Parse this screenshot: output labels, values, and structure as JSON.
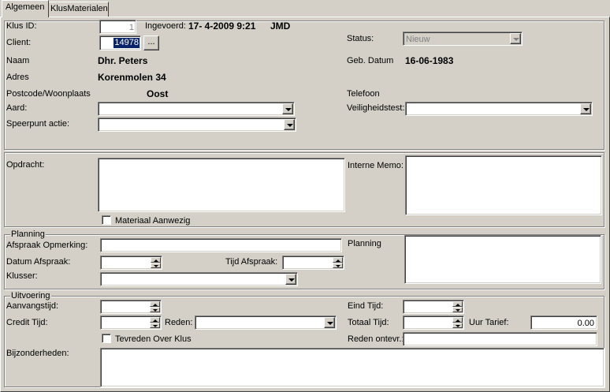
{
  "tabs": [
    {
      "label": "Algemeen",
      "active": true
    },
    {
      "label": "KlusMaterialen",
      "active": false
    }
  ],
  "klus": {
    "id_label": "Klus ID:",
    "id_value": "1",
    "ingevoerd_label": "Ingevoerd:",
    "ingevoerd_value": "17- 4-2009 9:21",
    "user_value": "JMD",
    "client_label": "Client:",
    "client_value": "14978",
    "client_browse": "...",
    "status_label": "Status:",
    "status_value": "Nieuw",
    "naam_label": "Naam",
    "naam_value": "Dhr. Peters",
    "geb_label": "Geb. Datum",
    "geb_value": "16-06-1983",
    "adres_label": "Adres",
    "adres_value": "Korenmolen 34",
    "postcode_label": "Postcode/Woonplaats",
    "postcode_value": "Oost",
    "telefoon_label": "Telefoon",
    "aard_label": "Aard:",
    "aard_value": "",
    "veiligheid_label": "Veiligheidstest:",
    "veiligheid_value": "",
    "speerpunt_label": "Speerpunt actie:",
    "speerpunt_value": ""
  },
  "opdracht": {
    "opdracht_label": "Opdracht:",
    "memo_label": "Interne Memo:",
    "materiaal_label": "Materiaal Aanwezig"
  },
  "planning": {
    "group_label": "Planning",
    "opmerking_label": "Afspraak Opmerking:",
    "planning_label": "Planning",
    "datum_label": "Datum Afspraak:",
    "tijd_label": "Tijd Afspraak:",
    "klusser_label": "Klusser:"
  },
  "uitvoering": {
    "group_label": "Uitvoering",
    "aanvang_label": "Aanvangstijd:",
    "eind_label": "Eind Tijd:",
    "credit_label": "Credit Tijd:",
    "reden_label": "Reden:",
    "totaal_label": "Totaal Tijd:",
    "tarief_label": "Uur Tarief:",
    "tarief_value": "0.00",
    "tevreden_label": "Tevreden Over Klus",
    "ontevr_label": "Reden ontevr.:",
    "bijzonder_label": "Bijzonderheden:"
  }
}
